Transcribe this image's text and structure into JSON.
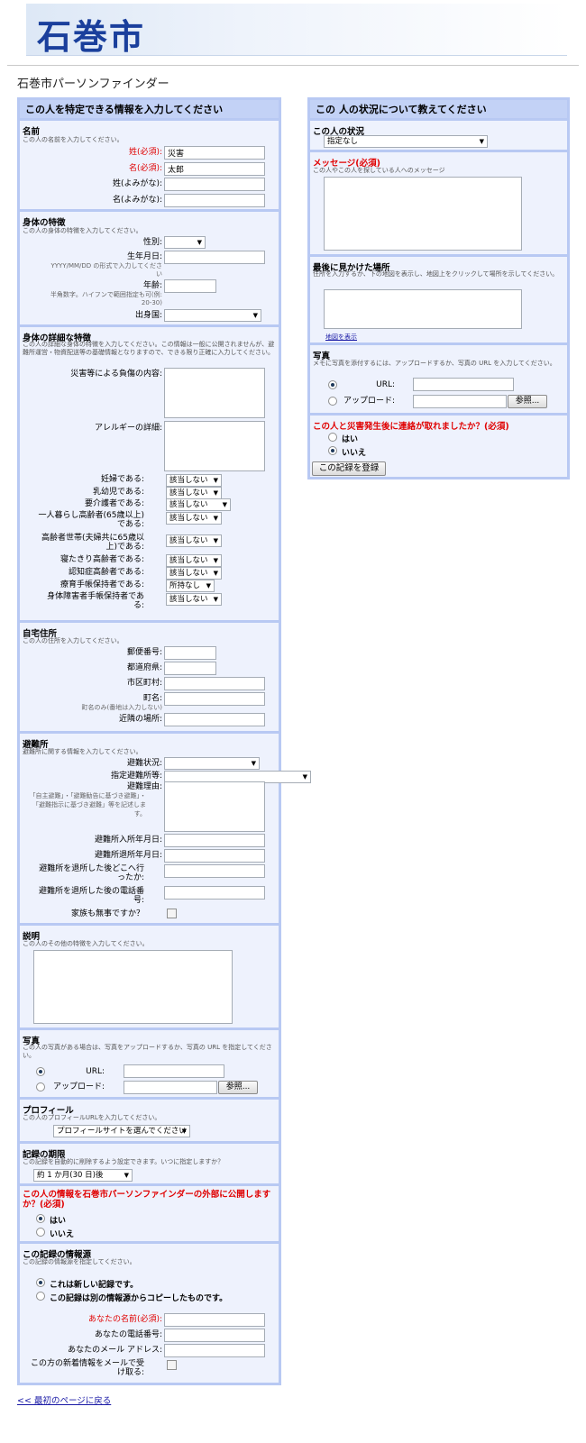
{
  "header": {
    "logo": "石巻市",
    "page_title": "石巻市パーソンファインダー"
  },
  "left": {
    "heading": "この人を特定できる情報を入力してください",
    "name": {
      "title": "名前",
      "desc": "この人の名前を入力してください。",
      "family_label": "姓(必須):",
      "family_value": "災害",
      "given_label": "名(必須):",
      "given_value": "太郎",
      "family_kana_label": "姓(よみがな):",
      "given_kana_label": "名(よみがな):"
    },
    "body": {
      "title": "身体の特徴",
      "desc": "この人の身体の特徴を入力してください。",
      "sex_label": "性別:",
      "dob_label": "生年月日:",
      "dob_hint": "YYYY/MM/DD の形式で入力してください",
      "age_label": "年齢:",
      "age_hint": "半角数字。ハイフンで範囲指定も可(例: 20-30)",
      "origin_label": "出身国:"
    },
    "detail": {
      "title": "身体の詳細な特徴",
      "desc": "この人の詳細な身体の特徴を入力してください。この情報は一般に公開されませんが、避難所運営・物資配送等の基礎情報となりますので、できる限り正確に入力してください。",
      "injury_label": "災害等による負傷の内容:",
      "allergy_label": "アレルギーの詳細:",
      "rows": [
        {
          "label": "妊婦である:",
          "value": "該当しない"
        },
        {
          "label": "乳幼児である:",
          "value": "該当しない"
        },
        {
          "label": "要介護者である:",
          "value": "該当しない"
        },
        {
          "label": "一人暮らし高齢者(65歳以上)である:",
          "value": "該当しない"
        },
        {
          "label": "高齢者世帯(夫婦共に65歳以上)である:",
          "value": "該当しない"
        },
        {
          "label": "寝たきり高齢者である:",
          "value": "該当しない"
        },
        {
          "label": "認知症高齢者である:",
          "value": "該当しない"
        },
        {
          "label": "療育手帳保持者である:",
          "value": "所持なし"
        },
        {
          "label": "身体障害者手帳保持者である:",
          "value": "該当しない"
        }
      ]
    },
    "address": {
      "title": "自宅住所",
      "desc": "この人の住所を入力してください。",
      "zip_label": "郵便番号:",
      "pref_label": "都道府県:",
      "city_label": "市区町村:",
      "town_label": "町名:",
      "town_hint": "町名のみ(番地は入力しない)",
      "near_label": "近隣の場所:"
    },
    "shelter": {
      "title": "避難所",
      "desc": "避難所に関する情報を入力してください。",
      "status_label": "避難状況:",
      "assigned_label": "指定避難所等:",
      "reason_label": "避難理由:",
      "reason_hint": "「自主避難」・「避難勧告に基づき避難」・「避難指示に基づき避難」等を記述します。",
      "in_label": "避難所入所年月日:",
      "out_label": "避難所退所年月日:",
      "where_label": "避難所を退所した後どこへ行ったか:",
      "phone_label": "避難所を退所した後の電話番号:",
      "family_label": "家族も無事ですか？"
    },
    "desc": {
      "title": "説明",
      "desc": "この人のその他の特徴を入力してください。"
    },
    "photo": {
      "title": "写真",
      "desc": "この人の写真がある場合は、写真をアップロードするか、写真の URL を指定してください。",
      "url_label": "URL:",
      "upload_label": "アップロード:",
      "browse": "参照..."
    },
    "profile": {
      "title": "プロフィール",
      "desc": "この人のプロフィールURLを入力してください。",
      "select": "プロフィールサイトを選んでください"
    },
    "expiry": {
      "title": "記録の期限",
      "desc": "この記録を自動的に削除するよう設定できます。いつに指定しますか？",
      "select": "約 1 か月(30 日)後"
    },
    "publish": {
      "title": "この人の情報を石巻市パーソンファインダーの外部に公開しますか？(必須)",
      "yes": "はい",
      "no": "いいえ"
    },
    "source": {
      "title": "この記録の情報源",
      "desc": "この記録の情報源を指定してください。",
      "new": "これは新しい記録です。",
      "copy": "この記録は別の情報源からコピーしたものです。",
      "your_name_label": "あなたの名前(必須):",
      "your_phone_label": "あなたの電話番号:",
      "your_email_label": "あなたのメール アドレス:",
      "subscribe_label": "この方の新着情報をメールで受け取る:"
    }
  },
  "right": {
    "heading": "この 人の状況について教えてください",
    "status": {
      "title": "この人の状況",
      "select": "指定なし"
    },
    "message": {
      "title": "メッセージ(必須)",
      "desc": "この人やこの人を探している人へのメッセージ"
    },
    "last_seen": {
      "title": "最後に見かけた場所",
      "desc": "住所を入力するか、下の地図を表示し、地図上をクリックして場所を示してください。",
      "map_link": "地図を表示"
    },
    "photo": {
      "title": "写真",
      "desc": "メモに写真を添付するには、アップロードするか、写真の URL を入力してください。",
      "url_label": "URL:",
      "upload_label": "アップロード:",
      "browse": "参照..."
    },
    "contact": {
      "title": "この人と災害発生後に連絡が取れましたか？(必須)",
      "yes": "はい",
      "no": "いいえ"
    },
    "submit": "この記録を登録"
  },
  "footer": {
    "back_link": "<< 最初のページに戻る"
  }
}
